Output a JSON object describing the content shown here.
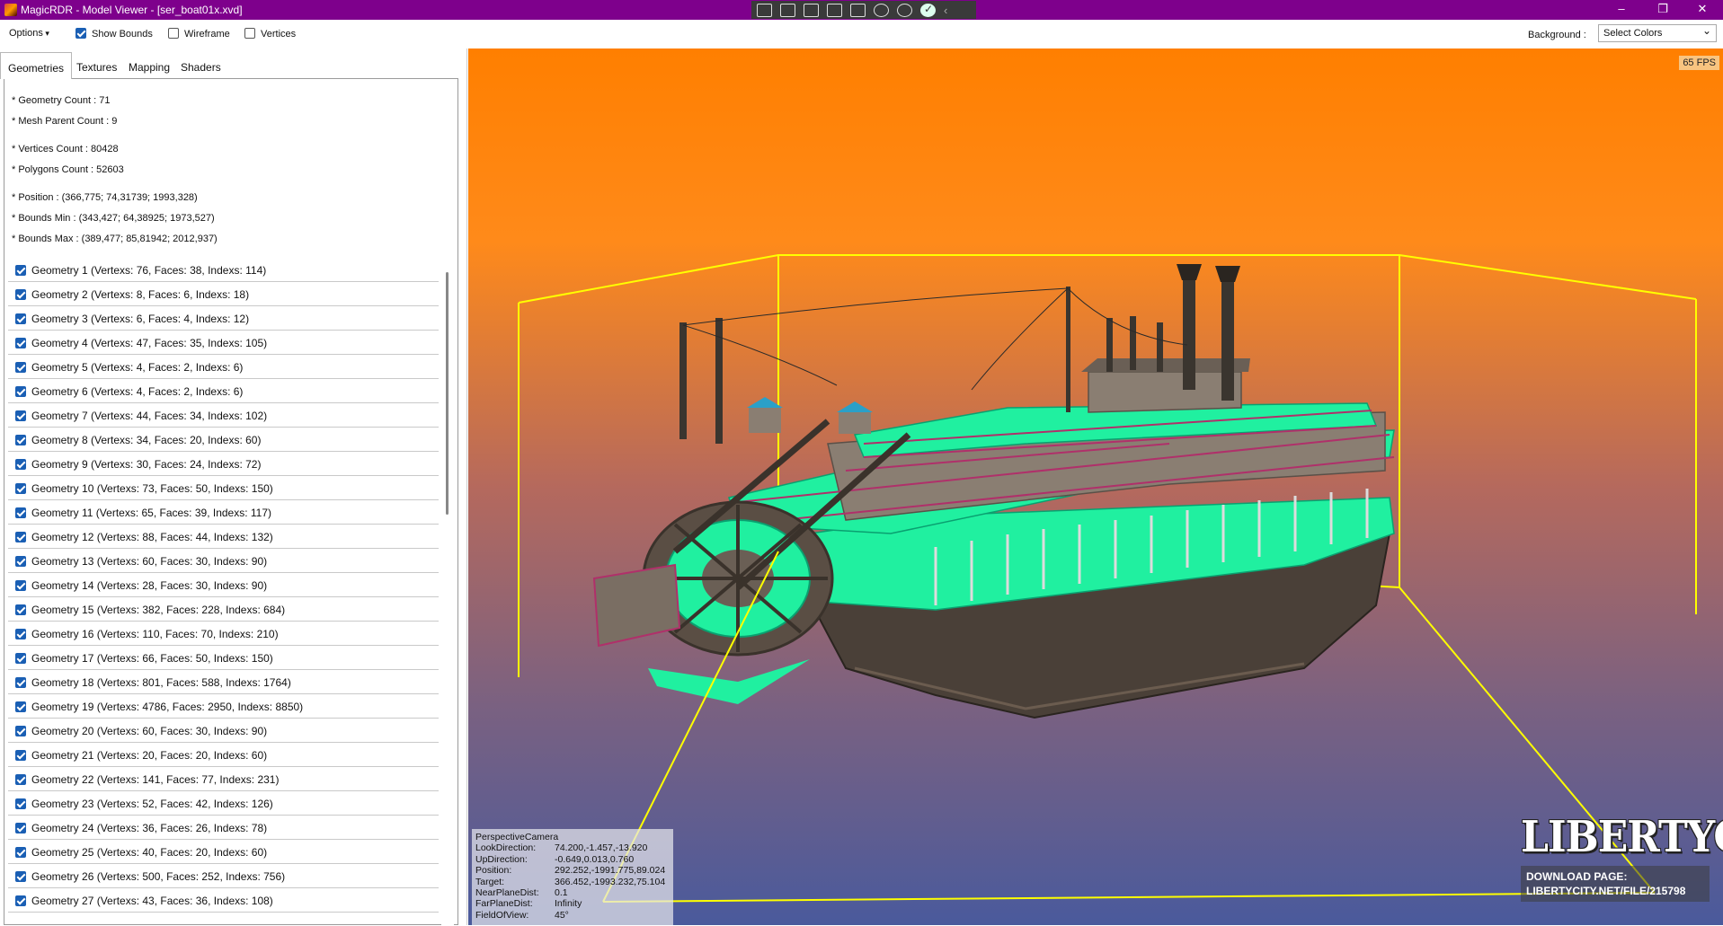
{
  "window": {
    "title": "MagicRDR - Model Viewer - [ser_boat01x.xvd]",
    "toolbar_icons": [
      "screenshot-icon",
      "camera-icon",
      "cursor-icon",
      "select-icon",
      "touch-icon",
      "headset-icon",
      "accessibility-icon",
      "check-icon",
      "chevron-left-icon"
    ],
    "controls": {
      "minimize": "–",
      "maximize": "❐",
      "close": "✕"
    }
  },
  "optbar": {
    "options_label": "Options",
    "show_bounds": {
      "label": "Show Bounds",
      "checked": true
    },
    "wireframe": {
      "label": "Wireframe",
      "checked": false
    },
    "vertices": {
      "label": "Vertices",
      "checked": false
    },
    "background_label": "Background :",
    "background_value": "Select Colors"
  },
  "tabs": [
    "Geometries",
    "Textures",
    "Mapping",
    "Shaders"
  ],
  "active_tab": "Geometries",
  "info": {
    "geometry_count": "* Geometry Count : 71",
    "mesh_parent_count": "* Mesh Parent Count : 9",
    "vertices_count": "* Vertices Count : 80428",
    "polygons_count": "* Polygons Count : 52603",
    "position": "* Position : (366,775; 74,31739; 1993,328)",
    "bounds_min": "* Bounds Min : (343,427; 64,38925; 1973,527)",
    "bounds_max": "* Bounds Max : (389,477; 85,81942; 2012,937)"
  },
  "geometries": [
    "Geometry 1 (Vertexs: 76, Faces: 38, Indexs: 114)",
    "Geometry 2 (Vertexs: 8, Faces: 6, Indexs: 18)",
    "Geometry 3 (Vertexs: 6, Faces: 4, Indexs: 12)",
    "Geometry 4 (Vertexs: 47, Faces: 35, Indexs: 105)",
    "Geometry 5 (Vertexs: 4, Faces: 2, Indexs: 6)",
    "Geometry 6 (Vertexs: 4, Faces: 2, Indexs: 6)",
    "Geometry 7 (Vertexs: 44, Faces: 34, Indexs: 102)",
    "Geometry 8 (Vertexs: 34, Faces: 20, Indexs: 60)",
    "Geometry 9 (Vertexs: 30, Faces: 24, Indexs: 72)",
    "Geometry 10 (Vertexs: 73, Faces: 50, Indexs: 150)",
    "Geometry 11 (Vertexs: 65, Faces: 39, Indexs: 117)",
    "Geometry 12 (Vertexs: 88, Faces: 44, Indexs: 132)",
    "Geometry 13 (Vertexs: 60, Faces: 30, Indexs: 90)",
    "Geometry 14 (Vertexs: 28, Faces: 30, Indexs: 90)",
    "Geometry 15 (Vertexs: 382, Faces: 228, Indexs: 684)",
    "Geometry 16 (Vertexs: 110, Faces: 70, Indexs: 210)",
    "Geometry 17 (Vertexs: 66, Faces: 50, Indexs: 150)",
    "Geometry 18 (Vertexs: 801, Faces: 588, Indexs: 1764)",
    "Geometry 19 (Vertexs: 4786, Faces: 2950, Indexs: 8850)",
    "Geometry 20 (Vertexs: 60, Faces: 30, Indexs: 90)",
    "Geometry 21 (Vertexs: 20, Faces: 20, Indexs: 60)",
    "Geometry 22 (Vertexs: 141, Faces: 77, Indexs: 231)",
    "Geometry 23 (Vertexs: 52, Faces: 42, Indexs: 126)",
    "Geometry 24 (Vertexs: 36, Faces: 26, Indexs: 78)",
    "Geometry 25 (Vertexs: 40, Faces: 20, Indexs: 60)",
    "Geometry 26 (Vertexs: 500, Faces: 252, Indexs: 756)",
    "Geometry 27 (Vertexs: 43, Faces: 36, Indexs: 108)"
  ],
  "viewport": {
    "fps": "65 FPS",
    "camera": {
      "name": "PerspectiveCamera",
      "rows": [
        {
          "key": "LookDirection:",
          "value": "74.200,-1.457,-13.920"
        },
        {
          "key": "UpDirection:",
          "value": "-0.649,0.013,0.760"
        },
        {
          "key": "Position:",
          "value": "292.252,-1991.775,89.024"
        },
        {
          "key": "Target:",
          "value": "366.452,-1993.232,75.104"
        },
        {
          "key": "NearPlaneDist:",
          "value": "0.1"
        },
        {
          "key": "FarPlaneDist:",
          "value": "Infinity"
        },
        {
          "key": "FieldOfView:",
          "value": "45°"
        }
      ]
    },
    "watermark": {
      "logo": "LIBERTYCITY",
      "line1": "DOWNLOAD PAGE:",
      "line2": "LIBERTYCITY.NET/FILE/215798"
    }
  },
  "colors": {
    "titlebar": "#7e008c",
    "bounds": "#ffff00",
    "deck": "#20f0a0",
    "hull": "#4a4038",
    "rail": "#b0306a"
  }
}
